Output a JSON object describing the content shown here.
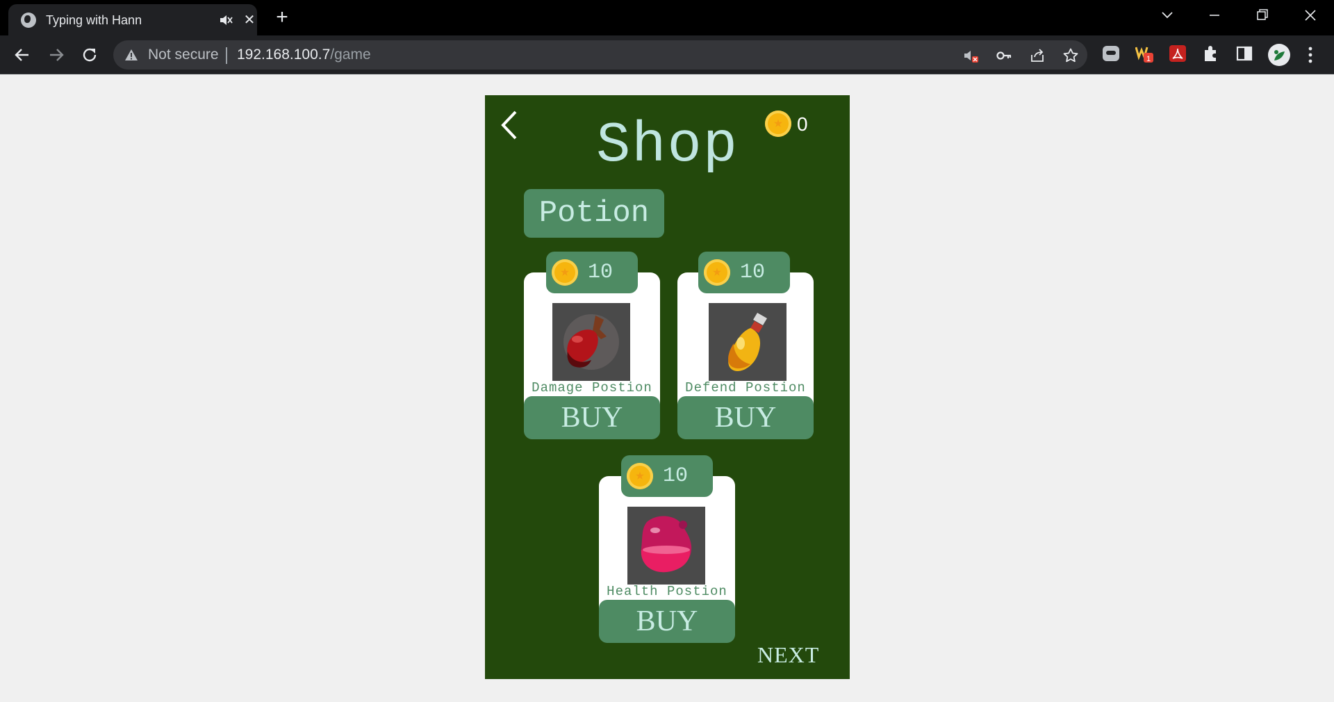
{
  "browser": {
    "tab_title": "Typing with Hann",
    "omnibox": {
      "security_label": "Not secure",
      "url_host": "192.168.100.7",
      "url_path": "/game"
    },
    "extension_badge": "1"
  },
  "game": {
    "title": "Shop",
    "coin_balance": "0",
    "category_tab": "Potion",
    "items": [
      {
        "name": "Damage Postion",
        "price": "10",
        "button_label": "BUY",
        "potion_color": "#b3141a"
      },
      {
        "name": "Defend Postion",
        "price": "10",
        "button_label": "BUY",
        "potion_color": "#f2b413"
      },
      {
        "name": "Health Postion",
        "price": "10",
        "button_label": "BUY",
        "potion_color": "#d42a7c"
      }
    ],
    "next_label": "NEXT",
    "colors": {
      "background": "#23490c",
      "panel": "#4e8b63",
      "text_light": "#c8ece3",
      "coin": "#f6b50e"
    }
  }
}
